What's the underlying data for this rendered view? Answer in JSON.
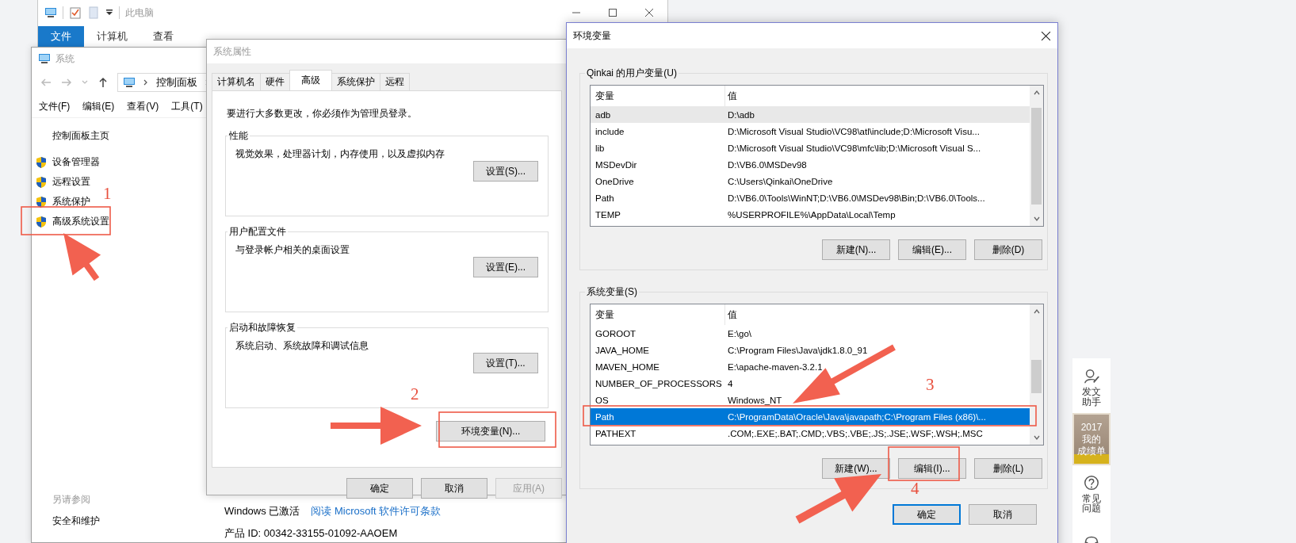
{
  "explorer_window": {
    "title": "此电脑",
    "ribbon_tabs": [
      {
        "label": "文件",
        "selected": true
      },
      {
        "label": "计算机",
        "selected": false
      },
      {
        "label": "查看",
        "selected": false
      }
    ]
  },
  "system_window": {
    "title": "系统",
    "breadcrumb": "控制面板",
    "menu": [
      "文件(F)",
      "编辑(E)",
      "查看(V)",
      "工具(T)"
    ],
    "home_link": "控制面板主页",
    "links": [
      "设备管理器",
      "远程设置",
      "系统保护",
      "高级系统设置"
    ],
    "see_also_title": "另请参阅",
    "see_also": [
      "安全和维护"
    ],
    "activation_status": "Windows 已激活",
    "license_link": "阅读 Microsoft 软件许可条款",
    "product_id": "产品 ID: 00342-33155-01092-AAOEM"
  },
  "properties_dialog": {
    "title": "系统属性",
    "active": false,
    "tabs": [
      {
        "label": "计算机名",
        "selected": false
      },
      {
        "label": "硬件",
        "selected": false
      },
      {
        "label": "高级",
        "selected": true
      },
      {
        "label": "系统保护",
        "selected": false
      },
      {
        "label": "远程",
        "selected": false
      }
    ],
    "notice": "要进行大多数更改，你必须作为管理员登录。",
    "groups": [
      {
        "title": "性能",
        "text": "视觉效果，处理器计划，内存使用，以及虚拟内存",
        "button": "设置(S)..."
      },
      {
        "title": "用户配置文件",
        "text": "与登录帐户相关的桌面设置",
        "button": "设置(E)..."
      },
      {
        "title": "启动和故障恢复",
        "text": "系统启动、系统故障和调试信息",
        "button": "设置(T)..."
      }
    ],
    "env_button": "环境变量(N)...",
    "buttons": [
      {
        "label": "确定",
        "disabled": false
      },
      {
        "label": "取消",
        "disabled": false
      },
      {
        "label": "应用(A)",
        "disabled": true
      }
    ]
  },
  "env_dialog": {
    "title": "环境变量",
    "active": true,
    "user_vars": {
      "title": "Qinkai 的用户变量(U)",
      "focused": false,
      "columns": [
        "变量",
        "值"
      ],
      "rows": [
        {
          "name": "adb",
          "value": "D:\\adb",
          "selected": true
        },
        {
          "name": "include",
          "value": "D:\\Microsoft Visual Studio\\VC98\\atl\\include;D:\\Microsoft Visu...",
          "selected": false
        },
        {
          "name": "lib",
          "value": "D:\\Microsoft Visual Studio\\VC98\\mfc\\lib;D:\\Microsoft Visual S...",
          "selected": false
        },
        {
          "name": "MSDevDir",
          "value": "D:\\VB6.0\\MSDev98",
          "selected": false
        },
        {
          "name": "OneDrive",
          "value": "C:\\Users\\Qinkai\\OneDrive",
          "selected": false
        },
        {
          "name": "Path",
          "value": "D:\\VB6.0\\Tools\\WinNT;D:\\VB6.0\\MSDev98\\Bin;D:\\VB6.0\\Tools...",
          "selected": false
        },
        {
          "name": "TEMP",
          "value": "%USERPROFILE%\\AppData\\Local\\Temp",
          "selected": false
        }
      ],
      "buttons": [
        "新建(N)...",
        "编辑(E)...",
        "删除(D)"
      ]
    },
    "system_vars": {
      "title": "系统变量(S)",
      "focused": true,
      "columns": [
        "变量",
        "值"
      ],
      "rows": [
        {
          "name": "GOROOT",
          "value": "E:\\go\\",
          "selected": false
        },
        {
          "name": "JAVA_HOME",
          "value": "C:\\Program Files\\Java\\jdk1.8.0_91",
          "selected": false
        },
        {
          "name": "MAVEN_HOME",
          "value": "E:\\apache-maven-3.2.1",
          "selected": false
        },
        {
          "name": "NUMBER_OF_PROCESSORS",
          "value": "4",
          "selected": false
        },
        {
          "name": "OS",
          "value": "Windows_NT",
          "selected": false
        },
        {
          "name": "Path",
          "value": "C:\\ProgramData\\Oracle\\Java\\javapath;C:\\Program Files (x86)\\...",
          "selected": true
        },
        {
          "name": "PATHEXT",
          "value": ".COM;.EXE;.BAT;.CMD;.VBS;.VBE;.JS;.JSE;.WSF;.WSH;.MSC",
          "selected": false
        }
      ],
      "buttons": [
        "新建(W)...",
        "编辑(I)...",
        "删除(L)"
      ]
    },
    "buttons": [
      {
        "label": "确定",
        "default": true
      },
      {
        "label": "取消",
        "default": false
      }
    ]
  },
  "side_toolbar": {
    "items": [
      {
        "kind": "assistant",
        "label": "发文助手"
      },
      {
        "kind": "promo",
        "lines": [
          "2017",
          "我的",
          "成绩单"
        ]
      },
      {
        "kind": "faq",
        "label": "常见问题"
      },
      {
        "kind": "support"
      }
    ]
  },
  "annotations": [
    {
      "number": "1"
    },
    {
      "number": "2"
    },
    {
      "number": "3"
    },
    {
      "number": "4"
    }
  ]
}
